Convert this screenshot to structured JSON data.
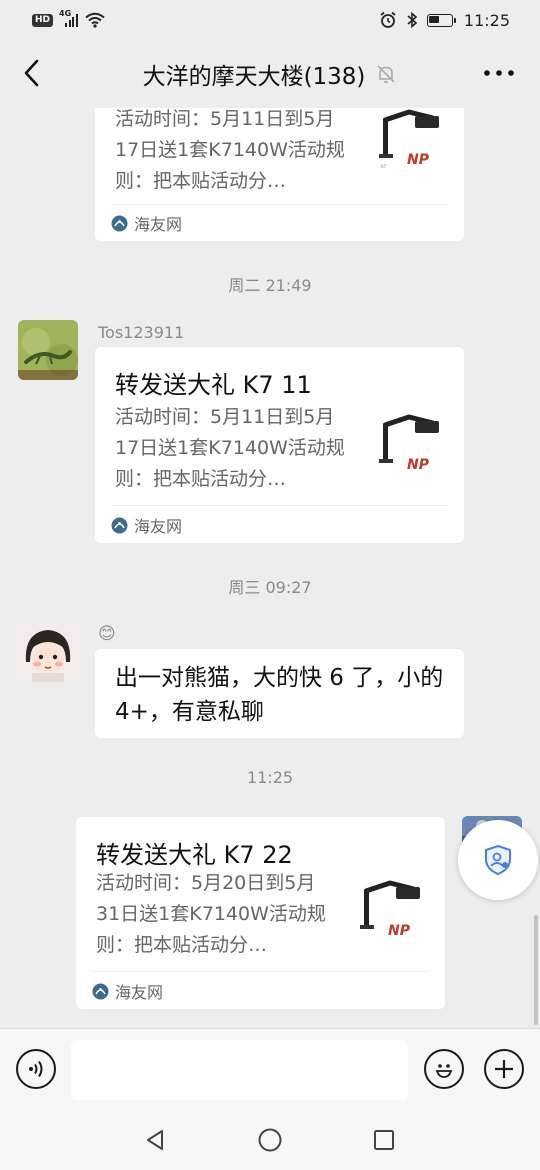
{
  "status_bar": {
    "hd_label": "HD",
    "network_label": "4G",
    "time": "11:25"
  },
  "header": {
    "title": "大洋的摩天大楼(138)",
    "back_icon": "chevron-left-icon",
    "mute_icon": "bell-off-icon",
    "more_icon": "ellipsis-icon"
  },
  "messages": [
    {
      "type": "link_card",
      "desc": "活动时间：5月11日到5月17日送1套K7140W活动规则：把本贴活动分…",
      "source": "海友网"
    },
    {
      "type": "time",
      "text": "周二 21:49"
    },
    {
      "type": "link_card",
      "sender": "Tos123911",
      "title": "转发送大礼 K7 11",
      "desc": "活动时间：5月11日到5月17日送1套K7140W活动规则：把本贴活动分…",
      "source": "海友网"
    },
    {
      "type": "time",
      "text": "周三 09:27"
    },
    {
      "type": "text",
      "sender": "😊",
      "text": "出一对熊猫，大的快 6 了，小的 4+，有意私聊"
    },
    {
      "type": "time",
      "text": "11:25"
    },
    {
      "type": "link_card",
      "title": "转发送大礼 K7 22",
      "desc": "活动时间：5月20日到5月31日送1套K7140W活动规则：把本贴活动分…",
      "source": "海友网"
    }
  ],
  "input_bar": {
    "voice_icon": "voice-icon",
    "input_value": "",
    "emoji_icon": "smiley-icon",
    "plus_icon": "plus-icon"
  },
  "nav_bar": {
    "back_icon": "triangle-back-icon",
    "home_icon": "circle-home-icon",
    "recents_icon": "square-recents-icon"
  },
  "colors": {
    "background": "#ededed",
    "bubble": "#ffffff",
    "source_icon": "#3d6b8c"
  }
}
